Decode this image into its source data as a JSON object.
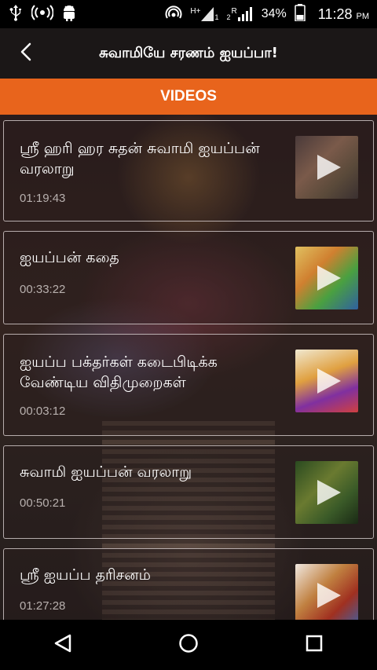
{
  "status": {
    "battery": "34%",
    "time": "11:28",
    "ampm": "PM",
    "network_type": "H+",
    "sim1": "1",
    "sim2": "2",
    "roaming": "R"
  },
  "header": {
    "title": "சுவாமியே சரணம் ஐயப்பா!"
  },
  "section": {
    "title": "VIDEOS"
  },
  "videos": [
    {
      "title": "ஸ்ரீ ஹரி ஹர சுதன் சுவாமி ஐயப்பன் வரலாறு",
      "duration": "01:19:43"
    },
    {
      "title": "ஐயப்பன் கதை",
      "duration": "00:33:22"
    },
    {
      "title": "ஐயப்ப பக்தர்கள் கடைபிடிக்க வேண்டிய விதிமுறைகள்",
      "duration": "00:03:12"
    },
    {
      "title": "சுவாமி ஐயப்பன் வரலாறு",
      "duration": "00:50:21"
    },
    {
      "title": "ஸ்ரீ ஐயப்ப தரிசனம்",
      "duration": "01:27:28"
    }
  ],
  "colors": {
    "accent": "#e8641c",
    "app_bar": "#1b1717",
    "status_bar": "#000000"
  },
  "icons": {
    "back": "chevron-left-icon",
    "play": "play-icon",
    "nav_back": "triangle-back-icon",
    "nav_home": "circle-home-icon",
    "nav_recent": "square-recents-icon"
  }
}
